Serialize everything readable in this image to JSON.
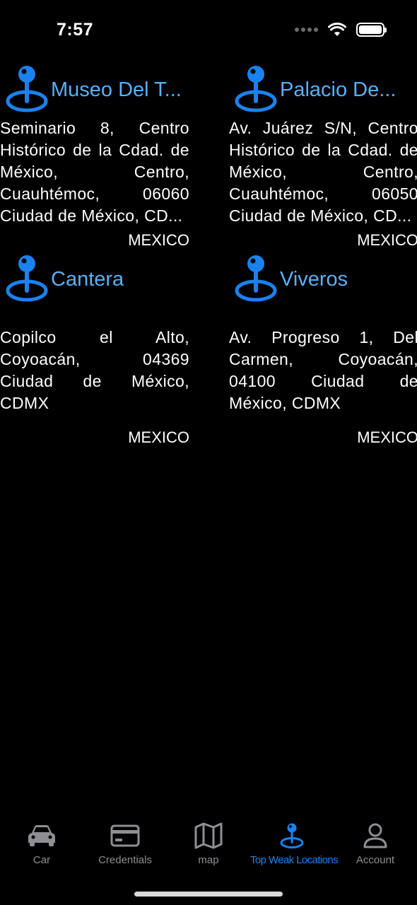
{
  "status_bar": {
    "time": "7:57"
  },
  "locations": [
    {
      "title": "Museo Del T...",
      "address": "Seminario 8, Centro Histórico de la Cdad. de México, Centro, Cuauhtémoc, 06060 Ciudad de México, CD...",
      "country": "MEXICO",
      "icon": "location-pin-icon"
    },
    {
      "title": "Palacio De...",
      "address": "Av. Juárez S/N, Centro Histórico de la Cdad. de México, Centro, Cuauhtémoc, 06050 Ciudad de México, CD...",
      "country": "MEXICO",
      "icon": "location-pin-icon"
    },
    {
      "title": "Cantera",
      "address": "Copilco el Alto, Coyoacán, 04369 Ciudad de México, CDMX",
      "country": "MEXICO",
      "icon": "location-pin-icon"
    },
    {
      "title": "Viveros",
      "address": "Av. Progreso 1, Del Carmen, Coyoacán, 04100 Ciudad de México, CDMX",
      "country": "MEXICO",
      "icon": "location-pin-icon"
    }
  ],
  "tabbar": {
    "selected": "Top Weak Locations",
    "tabs": [
      {
        "label": "Car",
        "icon": "car-icon"
      },
      {
        "label": "Credentials",
        "icon": "credit-card-icon"
      },
      {
        "label": "map",
        "icon": "map-icon"
      },
      {
        "label": "Top Weak Locations",
        "icon": "location-pin-icon"
      },
      {
        "label": "Account",
        "icon": "person-icon"
      }
    ]
  },
  "colors": {
    "accent": "#1a82f0",
    "title": "#5ab0f5",
    "inactive": "#8e8e93",
    "background": "#000000"
  }
}
